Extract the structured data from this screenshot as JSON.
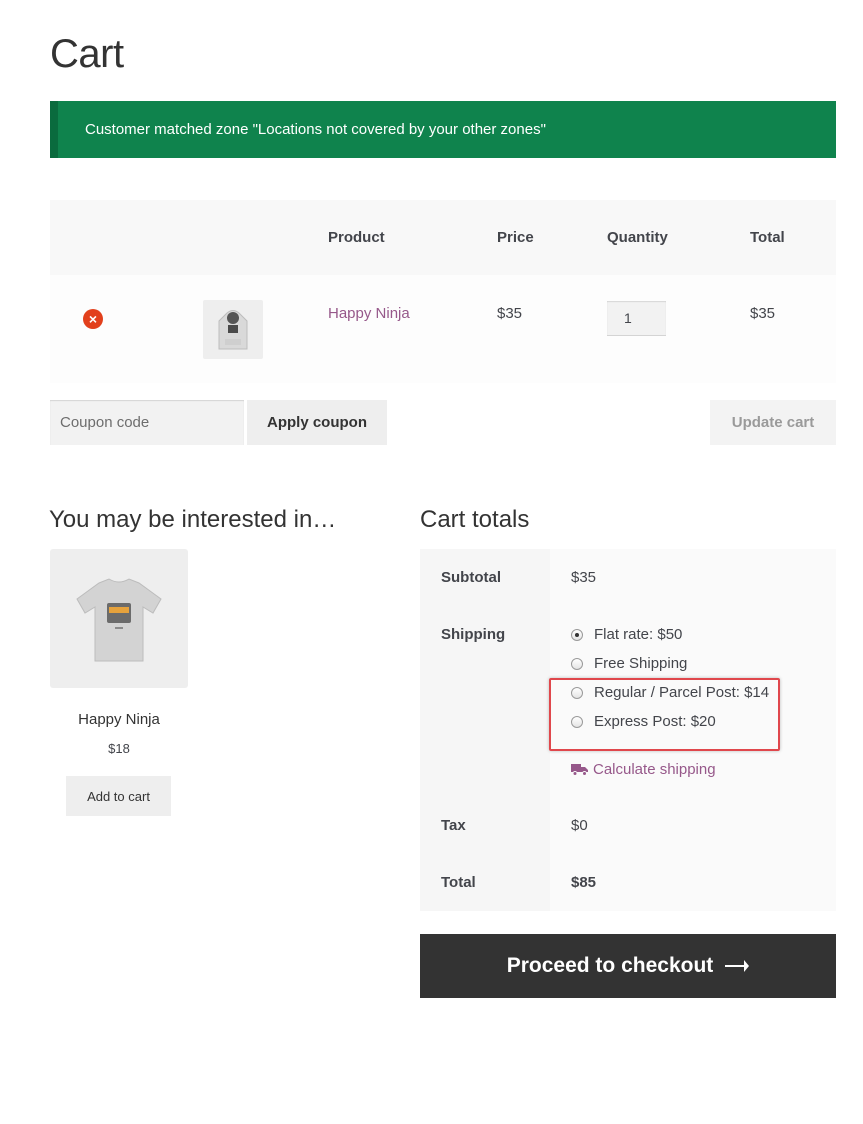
{
  "page": {
    "title": "Cart"
  },
  "notice": {
    "text": "Customer matched zone \"Locations not covered by your other zones\""
  },
  "cart_table": {
    "headers": {
      "product": "Product",
      "price": "Price",
      "quantity": "Quantity",
      "total": "Total"
    },
    "rows": [
      {
        "remove_icon": "remove-icon",
        "thumbnail_icon": "hoodie-icon",
        "product": "Happy Ninja",
        "price": "$35",
        "quantity": "1",
        "total": "$35"
      }
    ]
  },
  "coupon": {
    "placeholder": "Coupon code",
    "apply_label": "Apply coupon",
    "update_label": "Update cart"
  },
  "cross_sells": {
    "title": "You may be interested in…",
    "items": [
      {
        "image_icon": "tshirt-icon",
        "name": "Happy Ninja",
        "price": "$18",
        "add_label": "Add to cart"
      }
    ]
  },
  "cart_totals": {
    "title": "Cart totals",
    "subtotal_label": "Subtotal",
    "subtotal_value": "$35",
    "shipping_label": "Shipping",
    "shipping_options": [
      {
        "label": "Flat rate: $50",
        "checked": true
      },
      {
        "label": "Free Shipping",
        "checked": false
      },
      {
        "label": "Regular / Parcel Post: $14",
        "checked": false
      },
      {
        "label": "Express Post: $20",
        "checked": false
      }
    ],
    "calculate_shipping": "Calculate shipping",
    "tax_label": "Tax",
    "tax_value": "$0",
    "total_label": "Total",
    "total_value": "$85"
  },
  "checkout": {
    "label": "Proceed to checkout",
    "arrow_icon": "arrow-right-icon"
  },
  "colors": {
    "notice_bg": "#0f834d",
    "link": "#96588a",
    "remove": "#e2401c",
    "checkout_bg": "#333333",
    "highlight": "#e0474c"
  }
}
